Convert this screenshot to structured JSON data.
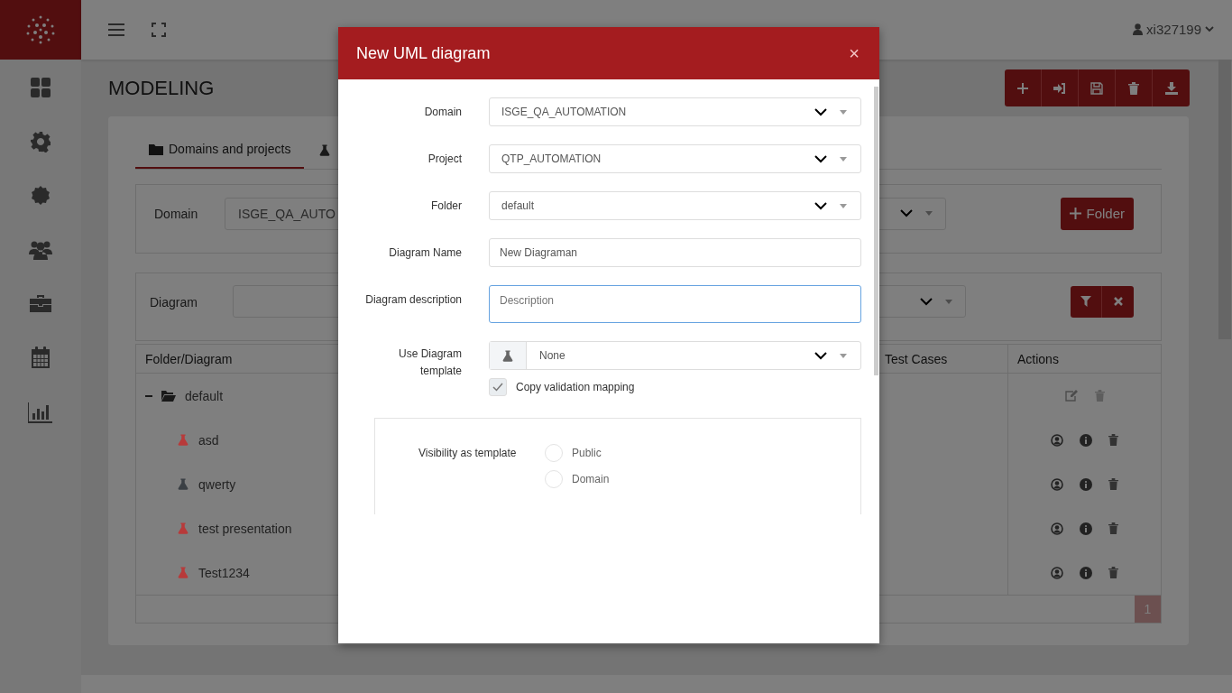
{
  "topbar": {
    "user": "xi327199"
  },
  "page": {
    "title": "MODELING"
  },
  "tabs": [
    {
      "label": "Domains and projects",
      "selected": true
    }
  ],
  "domain_filter": {
    "label": "Domain",
    "value": "ISGE_QA_AUTO",
    "button": "Folder"
  },
  "diagram_filter": {
    "label": "Diagram"
  },
  "table": {
    "columns": [
      "Folder/Diagram",
      "Test Cases",
      "Actions"
    ],
    "rows": [
      {
        "name": "default",
        "kind": "folder",
        "expanded": true
      },
      {
        "name": "asd",
        "kind": "diagram",
        "color": "#b83a3a"
      },
      {
        "name": "qwerty",
        "kind": "diagram",
        "color": "#3a3f44"
      },
      {
        "name": "test presentation",
        "kind": "diagram",
        "color": "#b83a3a"
      },
      {
        "name": "Test1234",
        "kind": "diagram",
        "color": "#b83a3a"
      }
    ]
  },
  "pagination": [
    {
      "label": "1",
      "selected": true
    }
  ],
  "modal": {
    "title": "New UML diagram",
    "close": "×",
    "fields": [
      {
        "label": "Domain",
        "kind": "select",
        "value": "ISGE_QA_AUTOMATION"
      },
      {
        "label": "Project",
        "kind": "select",
        "value": "QTP_AUTOMATION"
      },
      {
        "label": "Folder",
        "kind": "select",
        "value": "default"
      },
      {
        "label": "Diagram Name",
        "kind": "input",
        "value": "New Diagraman"
      },
      {
        "label": "Diagram description",
        "kind": "textarea",
        "placeholder": "Description",
        "focused": true
      },
      {
        "label": "Use Diagram template",
        "kind": "select-icon",
        "value": "None"
      }
    ],
    "checkbox": {
      "label": "Copy validation mapping",
      "checked": true
    },
    "visibility": {
      "label": "Visibility as template",
      "options": [
        {
          "label": "Public",
          "selected": false
        },
        {
          "label": "Domain",
          "selected": false
        }
      ]
    }
  }
}
